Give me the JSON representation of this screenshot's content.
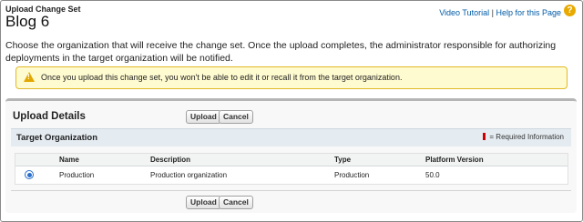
{
  "header": {
    "page_type": "Upload Change Set",
    "title": "Blog 6",
    "video_tutorial": "Video Tutorial",
    "separator": "|",
    "help_link": "Help for this Page",
    "help_icon": "?"
  },
  "intro_text": "Choose the organization that will receive the change set. Once the upload completes, the administrator responsible for authorizing deployments in the target organization will be notified.",
  "warning": {
    "icon": "warning-icon",
    "icon_glyph": "!",
    "text": "Once you upload this change set, you won't be able to edit it or recall it from the target organization."
  },
  "upload_details": {
    "title": "Upload Details",
    "upload_label": "Upload",
    "cancel_label": "Cancel"
  },
  "target_org": {
    "title": "Target Organization",
    "required_text": "= Required Information",
    "columns": [
      "Name",
      "Description",
      "Type",
      "Platform Version"
    ],
    "rows": [
      {
        "selected": true,
        "name": "Production",
        "description": "Production organization",
        "type": "Production",
        "platform_version": "50.0"
      }
    ]
  },
  "colors": {
    "link": "#015ba7",
    "warning_bg": "#fffbd0",
    "section_header": "#e4ebf1",
    "required": "#cc0000"
  }
}
